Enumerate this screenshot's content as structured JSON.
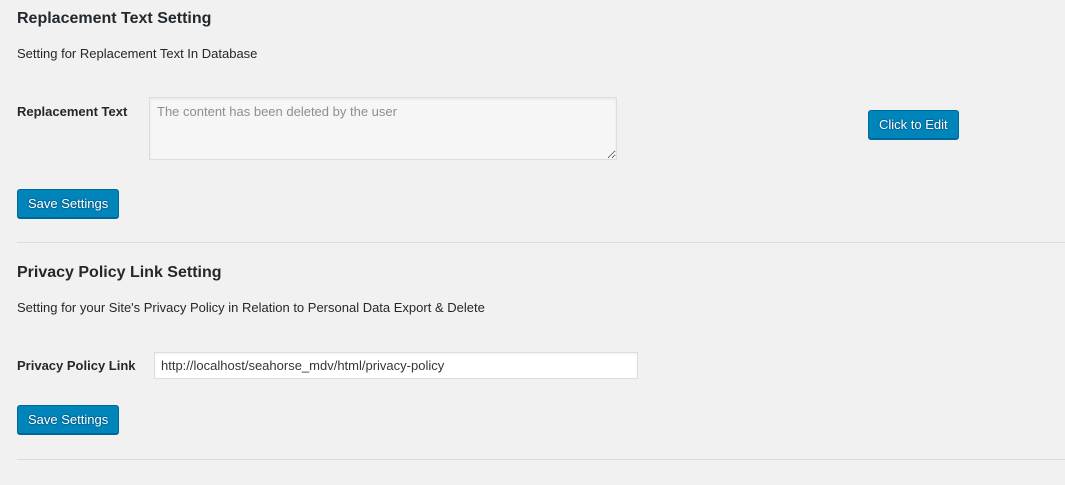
{
  "replacement_section": {
    "title": "Replacement Text Setting",
    "description": "Setting for Replacement Text In Database",
    "field_label": "Replacement Text",
    "textarea_placeholder": "The content has been deleted by the user",
    "edit_button_label": "Click to Edit",
    "save_button_label": "Save Settings"
  },
  "privacy_section": {
    "title": "Privacy Policy Link Setting",
    "description": "Setting for your Site's Privacy Policy in Relation to Personal Data Export & Delete",
    "field_label": "Privacy Policy Link",
    "link_value": "http://localhost/seahorse_mdv/html/privacy-policy",
    "save_button_label": "Save Settings"
  },
  "colors": {
    "background": "#f1f1f1",
    "primary_button": "#0085ba",
    "text": "#23282d"
  }
}
